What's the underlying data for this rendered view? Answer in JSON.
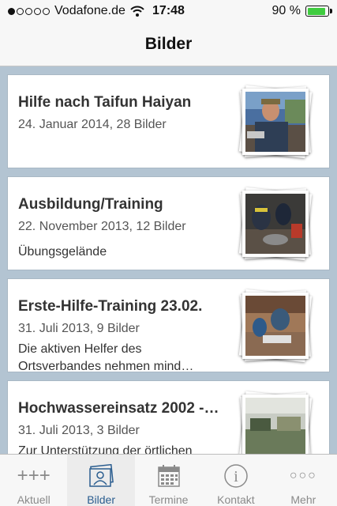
{
  "status": {
    "carrier": "Vodafone.de",
    "signal_filled": 1,
    "signal_total": 5,
    "time": "17:48",
    "battery_text": "90 %",
    "battery_level": 0.9
  },
  "nav": {
    "title": "Bilder"
  },
  "albums": [
    {
      "title": "Hilfe nach Taifun Haiyan",
      "meta": "24. Januar 2014, 28 Bilder",
      "desc": ""
    },
    {
      "title": "Ausbildung/Training",
      "meta": "22. November 2013, 12 Bilder",
      "desc": "Übungsgelände"
    },
    {
      "title": "Erste-Hilfe-Training 23.02.",
      "meta": "31. Juli 2013, 9 Bilder",
      "desc": "Die aktiven Helfer des Ortsverbandes nehmen mind…"
    },
    {
      "title": "Hochwassereinsatz 2002 -…",
      "meta": "31. Juli 2013, 3 Bilder",
      "desc": "Zur Unterstützung der örtlichen"
    }
  ],
  "tabs": {
    "aktuell": {
      "label": "Aktuell",
      "icon": "+++"
    },
    "bilder": {
      "label": "Bilder"
    },
    "termine": {
      "label": "Termine"
    },
    "kontakt": {
      "label": "Kontakt",
      "icon": "i"
    },
    "mehr": {
      "label": "Mehr",
      "icon": "○○○"
    }
  },
  "colors": {
    "accent": "#2a5d8f",
    "battery": "#3fcc3f",
    "background": "#b3c4d2"
  }
}
